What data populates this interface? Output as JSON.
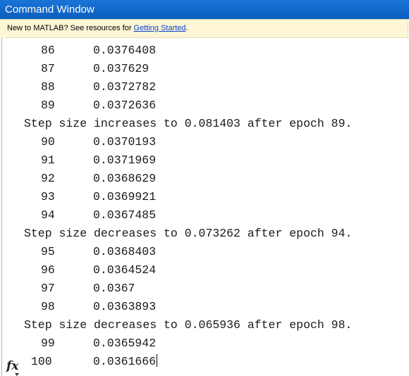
{
  "window": {
    "title": "Command Window"
  },
  "banner": {
    "text": "New to MATLAB? See resources for ",
    "link_label": "Getting Started",
    "suffix": "."
  },
  "console": {
    "lines": [
      {
        "type": "data",
        "epoch": "86",
        "value": "0.0376408"
      },
      {
        "type": "data",
        "epoch": "87",
        "value": "0.037629"
      },
      {
        "type": "data",
        "epoch": "88",
        "value": "0.0372782"
      },
      {
        "type": "data",
        "epoch": "89",
        "value": "0.0372636"
      },
      {
        "type": "message",
        "text": "Step size increases to 0.081403 after epoch 89."
      },
      {
        "type": "data",
        "epoch": "90",
        "value": "0.0370193"
      },
      {
        "type": "data",
        "epoch": "91",
        "value": "0.0371969"
      },
      {
        "type": "data",
        "epoch": "92",
        "value": "0.0368629"
      },
      {
        "type": "data",
        "epoch": "93",
        "value": "0.0369921"
      },
      {
        "type": "data",
        "epoch": "94",
        "value": "0.0367485"
      },
      {
        "type": "message",
        "text": "Step size decreases to 0.073262 after epoch 94."
      },
      {
        "type": "data",
        "epoch": "95",
        "value": "0.0368403"
      },
      {
        "type": "data",
        "epoch": "96",
        "value": "0.0364524"
      },
      {
        "type": "data",
        "epoch": "97",
        "value": "0.0367"
      },
      {
        "type": "data",
        "epoch": "98",
        "value": "0.0363893"
      },
      {
        "type": "message",
        "text": "Step size decreases to 0.065936 after epoch 98."
      },
      {
        "type": "data",
        "epoch": "99",
        "value": "0.0365942"
      },
      {
        "type": "data",
        "epoch": "100",
        "value": "0.0361666",
        "cursor": true
      }
    ]
  },
  "prompt": {
    "icon": "fx-icon",
    "symbol": "fx"
  }
}
